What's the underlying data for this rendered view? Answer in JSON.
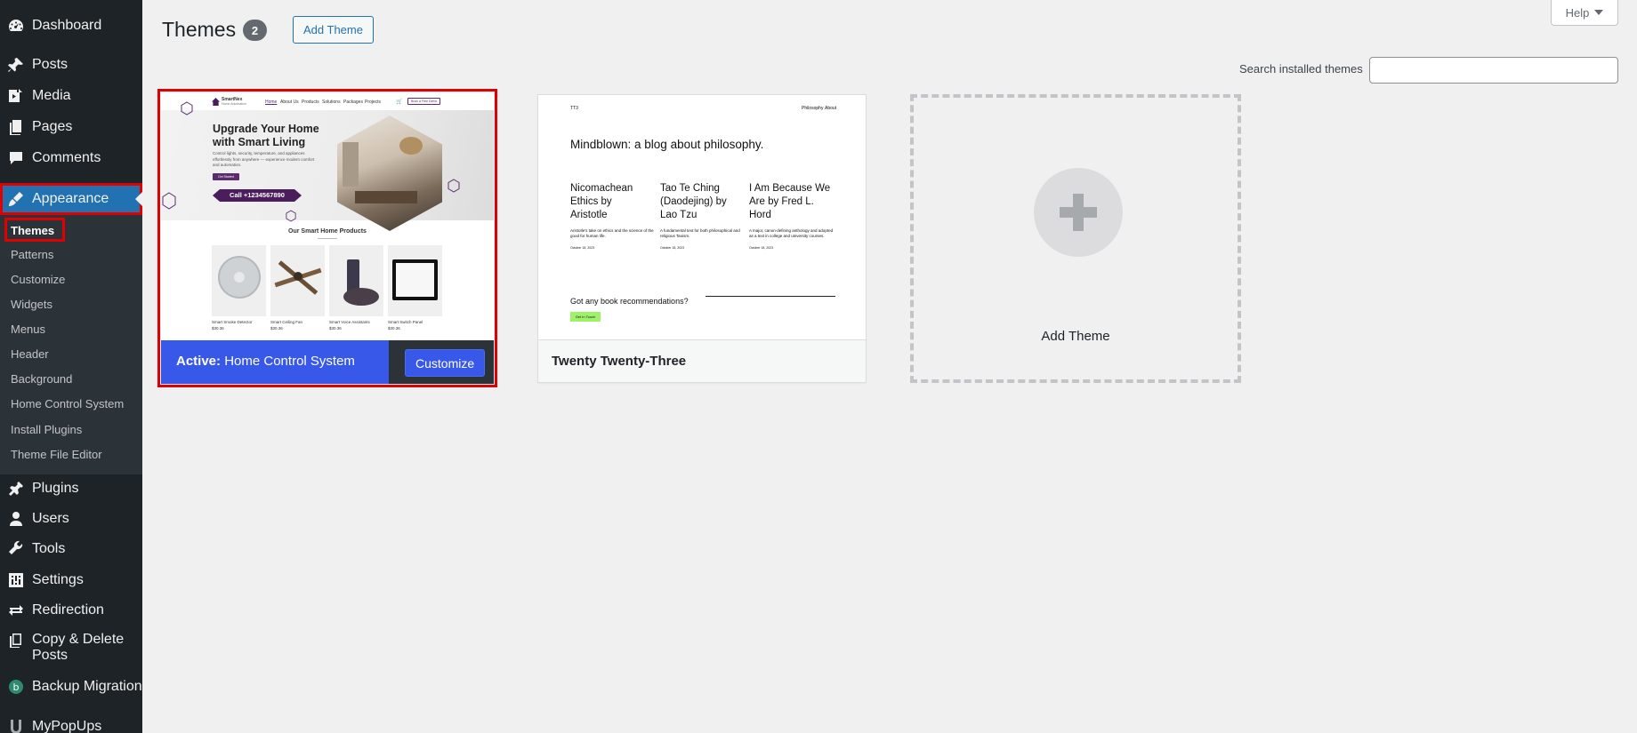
{
  "sidebar": {
    "items": [
      {
        "label": "Dashboard",
        "icon": "dashboard-icon"
      },
      {
        "label": "Posts",
        "icon": "pin-icon"
      },
      {
        "label": "Media",
        "icon": "media-icon"
      },
      {
        "label": "Pages",
        "icon": "pages-icon"
      },
      {
        "label": "Comments",
        "icon": "comments-icon"
      },
      {
        "label": "Appearance",
        "icon": "paintbrush-icon"
      },
      {
        "label": "Plugins",
        "icon": "plug-icon"
      },
      {
        "label": "Users",
        "icon": "user-icon"
      },
      {
        "label": "Tools",
        "icon": "wrench-icon"
      },
      {
        "label": "Settings",
        "icon": "settings-icon"
      },
      {
        "label": "Redirection",
        "icon": "redirect-icon"
      },
      {
        "label": "Copy & Delete Posts",
        "icon": "copy-icon"
      },
      {
        "label": "Backup Migration",
        "icon": "backup-icon"
      },
      {
        "label": "MyPopUps",
        "icon": "popup-icon"
      }
    ],
    "submenu": [
      {
        "label": "Themes",
        "current": true
      },
      {
        "label": "Patterns"
      },
      {
        "label": "Customize"
      },
      {
        "label": "Widgets"
      },
      {
        "label": "Menus"
      },
      {
        "label": "Header"
      },
      {
        "label": "Background"
      },
      {
        "label": "Home Control System"
      },
      {
        "label": "Install Plugins"
      },
      {
        "label": "Theme File Editor"
      }
    ]
  },
  "header": {
    "title": "Themes",
    "count": "2",
    "add_theme_label": "Add Theme",
    "help_label": "Help"
  },
  "search": {
    "label": "Search installed themes",
    "value": "",
    "placeholder": ""
  },
  "themes": {
    "active": {
      "active_prefix": "Active:",
      "name": "Home Control System",
      "customize_label": "Customize",
      "preview": {
        "brand": "SmartNex",
        "brand_sub": "Home Automation",
        "nav": [
          "Home",
          "About Us",
          "Products",
          "Solutions",
          "Packages",
          "Projects"
        ],
        "nav_button": "Book a Free Demo",
        "headline": "Upgrade Your Home with Smart Living",
        "body": "Control lights, security, temperature, and appliances effortlessly from anywhere — experience modern comfort and automation.",
        "cta": "Get Started",
        "call": "Call +1234567890",
        "products_title": "Our Smart Home Products",
        "products": [
          {
            "name": "Smart Smoke Detector",
            "price": "$30.36"
          },
          {
            "name": "Smart Ceiling Fan",
            "price": "$30.36"
          },
          {
            "name": "Smart Voice Assistants",
            "price": "$30.36"
          },
          {
            "name": "Smart Switch Panel",
            "price": "$30.36"
          }
        ]
      }
    },
    "second": {
      "name": "Twenty Twenty-Three",
      "preview": {
        "logo": "TT3",
        "nav": [
          "Philosophy",
          "About"
        ],
        "headline": "Mindblown: a blog about philosophy.",
        "posts": [
          {
            "title": "Nicomachean Ethics by Aristotle",
            "excerpt": "Aristotle's take on ethics and the science of the good for human life.",
            "date": "October 18, 2023"
          },
          {
            "title": "Tao Te Ching (Daodejing) by Lao Tzu",
            "excerpt": "A fundamental text for both philosophical and religious Taoism.",
            "date": "October 18, 2023"
          },
          {
            "title": "I Am Because We Are by Fred L. Hord",
            "excerpt": "A major, canon-defining anthology and adopted as a text in college and university courses.",
            "date": "October 18, 2023"
          }
        ],
        "cta_text": "Got any book recommendations?",
        "cta_button": "Get In Touch"
      }
    },
    "add_new_label": "Add Theme"
  },
  "colors": {
    "sidebar_bg": "#1d2327",
    "accent": "#2271b1",
    "active_bar": "#3858e9",
    "highlight": "#e00000"
  }
}
